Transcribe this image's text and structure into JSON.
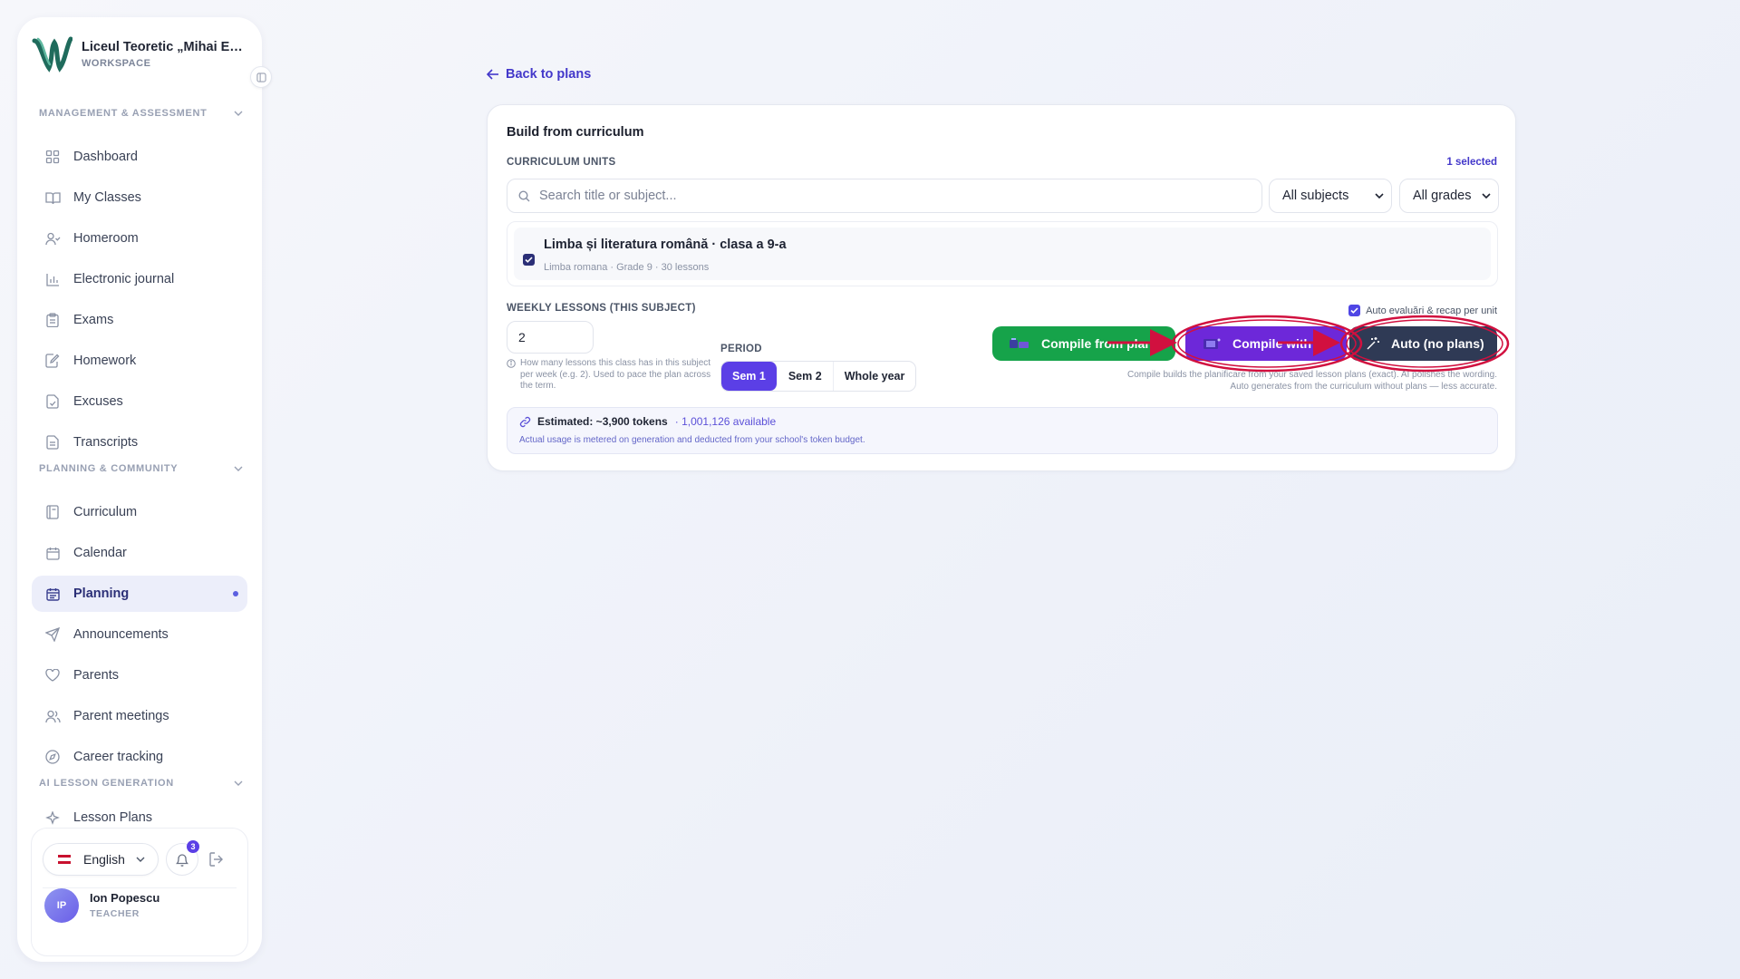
{
  "sidebar": {
    "brand_name": "Liceul Teoretic „Mihai Emi...",
    "brand_sub": "WORKSPACE",
    "sections": [
      {
        "title": "MANAGEMENT & ASSESSMENT"
      },
      {
        "title": "PLANNING & COMMUNITY"
      },
      {
        "title": "AI LESSON GENERATION"
      }
    ],
    "items": [
      {
        "label": "Dashboard",
        "icon": "grid-icon"
      },
      {
        "label": "My Classes",
        "icon": "book-open-icon"
      },
      {
        "label": "Homeroom",
        "icon": "user-check-icon"
      },
      {
        "label": "Electronic journal",
        "icon": "bar-chart-icon"
      },
      {
        "label": "Exams",
        "icon": "clipboard-icon"
      },
      {
        "label": "Homework",
        "icon": "edit-document-icon"
      },
      {
        "label": "Excuses",
        "icon": "file-check-icon"
      },
      {
        "label": "Transcripts",
        "icon": "file-text-icon"
      },
      {
        "label": "Curriculum",
        "icon": "notebook-icon"
      },
      {
        "label": "Calendar",
        "icon": "calendar-icon"
      },
      {
        "label": "Planning",
        "icon": "calendar-list-icon",
        "active": true
      },
      {
        "label": "Announcements",
        "icon": "send-icon"
      },
      {
        "label": "Parents",
        "icon": "heart-icon"
      },
      {
        "label": "Parent meetings",
        "icon": "users-icon"
      },
      {
        "label": "Career tracking",
        "icon": "compass-icon"
      },
      {
        "label": "Lesson Plans",
        "icon": "sparkle-icon"
      }
    ],
    "language": "English",
    "notifications_count": "3",
    "user": {
      "initials": "IP",
      "name": "Ion Popescu",
      "role": "TEACHER"
    }
  },
  "main": {
    "back_link": "Back to plans",
    "card_title": "Build from curriculum",
    "units_label": "CURRICULUM UNITS",
    "selected_count": "1 selected",
    "search_placeholder": "Search title or subject...",
    "subject_filter": "All subjects",
    "grade_filter": "All grades",
    "unit": {
      "title": "Limba și literatura română · clasa a 9-a",
      "meta": "Limba romana · Grade 9 · 30 lessons",
      "checked": true
    },
    "weekly_label": "WEEKLY LESSONS (THIS SUBJECT)",
    "weekly_value": "2",
    "weekly_help": "How many lessons this class has in this subject per week (e.g. 2). Used to pace the plan across the term.",
    "period_label": "PERIOD",
    "periods": [
      "Sem 1",
      "Sem 2",
      "Whole year"
    ],
    "active_period": "Sem 1",
    "auto_recap_label": "Auto evaluări & recap per unit",
    "buttons": {
      "compile_plans": "Compile from plans",
      "compile_with": "Compile with AI",
      "auto": "Auto (no plans)"
    },
    "compile_help_1": "Compile builds the planificare from your saved lesson plans (exact). AI polishes the wording.",
    "compile_help_2": "Auto generates from the curriculum without plans — less accurate.",
    "estimate_main": "Estimated: ~3,900 tokens",
    "estimate_available": "· 1,001,126 available",
    "estimate_note": "Actual usage is metered on generation and deducted from your school's token budget."
  },
  "colors": {
    "accent": "#5b3fe6",
    "green": "#16a34a",
    "purple": "#6d28d9",
    "dark": "#2f3a55",
    "annotation": "#d1103f"
  }
}
